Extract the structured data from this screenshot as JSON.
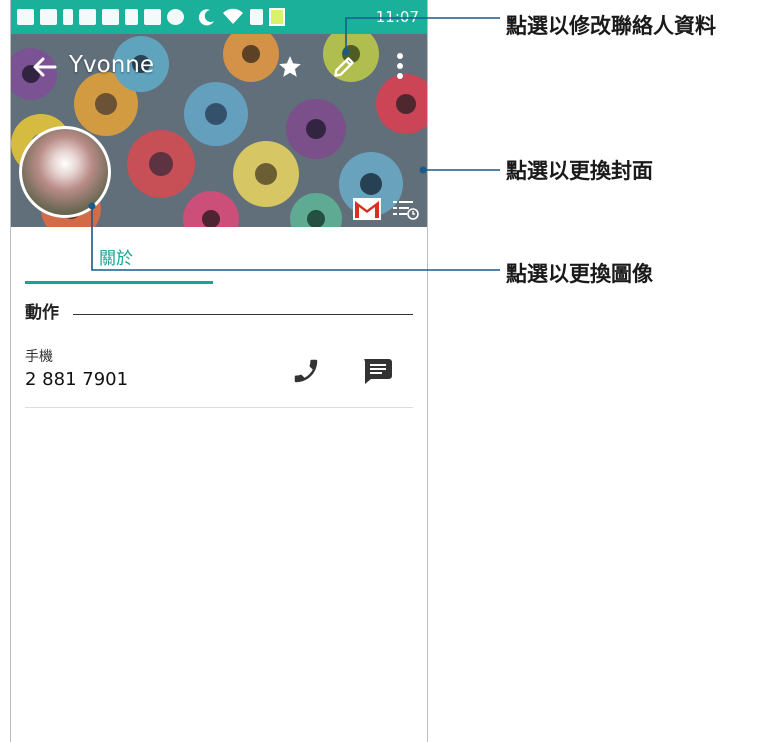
{
  "statusbar": {
    "time": "11:07"
  },
  "toolbar": {
    "contact_name": "Yvonne"
  },
  "tabs": [
    {
      "label": "關於"
    }
  ],
  "section": {
    "title": "動作"
  },
  "phone_entry": {
    "label": "手機",
    "number": "2 881 7901"
  },
  "callouts": [
    {
      "text": "點選以修改聯絡人資料"
    },
    {
      "text": "點選以更換封面"
    },
    {
      "text": "點選以更換圖像"
    }
  ],
  "colors": {
    "accent": "#1aa392",
    "statusbar": "#1bb09a"
  },
  "icons": [
    "back-arrow-icon",
    "star-icon",
    "edit-pencil-icon",
    "more-vert-icon",
    "gmail-icon",
    "schedule-list-icon",
    "phone-call-icon",
    "message-icon"
  ]
}
